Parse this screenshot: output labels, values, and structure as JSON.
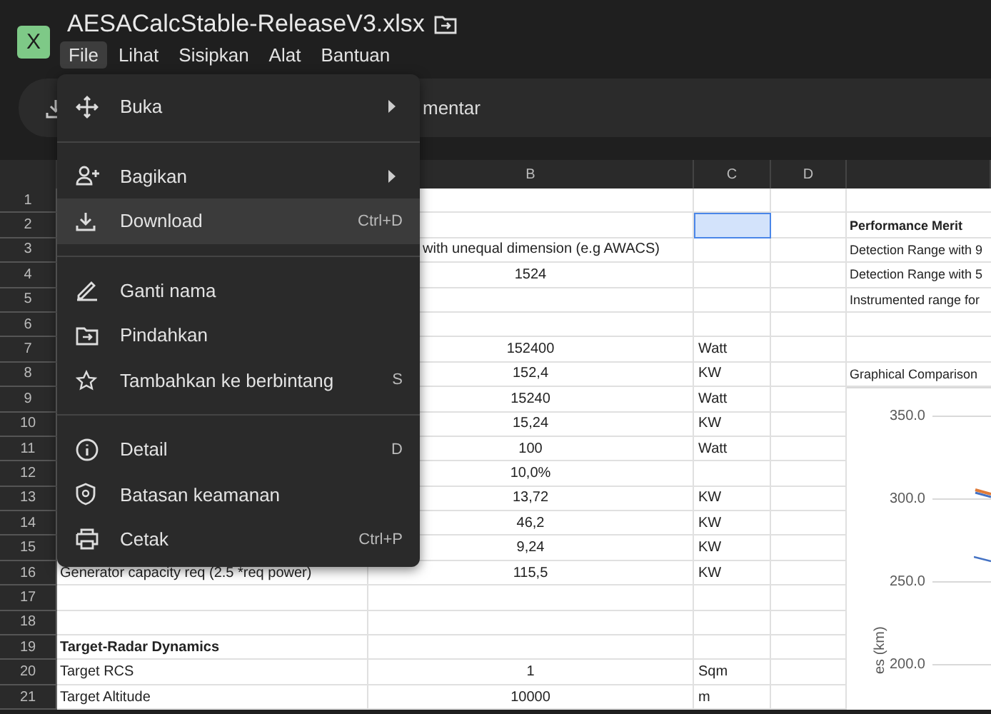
{
  "file": {
    "title": "AESACalcStable-ReleaseV3.xlsx",
    "app_icon_letter": "X"
  },
  "menubar": [
    {
      "label": "File",
      "selected": true
    },
    {
      "label": "Lihat",
      "selected": false
    },
    {
      "label": "Sisipkan",
      "selected": false
    },
    {
      "label": "Alat",
      "selected": false
    },
    {
      "label": "Bantuan",
      "selected": false
    }
  ],
  "toolbar": {
    "comment_text": "mentar"
  },
  "file_menu": {
    "sections": [
      [
        {
          "kind": "open",
          "label": "Buka",
          "submenu": true,
          "selected": false
        }
      ],
      [
        {
          "kind": "share",
          "label": "Bagikan",
          "submenu": true,
          "selected": false
        },
        {
          "kind": "download",
          "label": "Download",
          "shortcut": "Ctrl+D",
          "selected": true
        }
      ],
      [
        {
          "kind": "rename",
          "label": "Ganti nama",
          "selected": false
        },
        {
          "kind": "move",
          "label": "Pindahkan",
          "selected": false
        },
        {
          "kind": "star",
          "label": "Tambahkan ke berbintang",
          "shortcut": "S",
          "selected": false
        }
      ],
      [
        {
          "kind": "details",
          "label": "Detail",
          "shortcut": "D",
          "selected": false
        },
        {
          "kind": "security",
          "label": "Batasan keamanan",
          "selected": false
        },
        {
          "kind": "print",
          "label": "Cetak",
          "shortcut": "Ctrl+P",
          "selected": false
        }
      ]
    ]
  },
  "columns": [
    {
      "label": "B"
    },
    {
      "label": "C"
    },
    {
      "label": "D"
    }
  ],
  "rows": [
    {
      "number": "1",
      "c_selected": false
    },
    {
      "number": "2",
      "c_selected": true,
      "e": "Performance Merit",
      "e_bold": true
    },
    {
      "number": "3",
      "c_selected": false,
      "overflow_text": "with unequal dimension (e.g AWACS)",
      "e": "Detection Range with 9"
    },
    {
      "number": "4",
      "c_selected": false,
      "b": "1524",
      "e": "Detection Range with 5"
    },
    {
      "number": "5",
      "c_selected": false,
      "e": "Instrumented range for"
    },
    {
      "number": "6",
      "c_selected": false
    },
    {
      "number": "7",
      "c_selected": false,
      "b": "152400",
      "c": "Watt"
    },
    {
      "number": "8",
      "c_selected": false,
      "b": "152,4",
      "c": "KW",
      "e": "Graphical Comparison"
    },
    {
      "number": "9",
      "c_selected": false,
      "b": "15240",
      "c": "Watt"
    },
    {
      "number": "10",
      "c_selected": false,
      "b": "15,24",
      "c": "KW"
    },
    {
      "number": "11",
      "c_selected": false,
      "b": "100",
      "c": "Watt"
    },
    {
      "number": "12",
      "c_selected": false,
      "b": "10,0%"
    },
    {
      "number": "13",
      "c_selected": false,
      "b": "13,72",
      "c": "KW"
    },
    {
      "number": "14",
      "c_selected": false,
      "b": "46,2",
      "c": "KW"
    },
    {
      "number": "15",
      "c_selected": false,
      "b": "9,24",
      "c": "KW"
    },
    {
      "number": "16",
      "c_selected": false,
      "a": "Generator capacity req  (2.5 *req power)",
      "b": "115,5",
      "c": "KW"
    },
    {
      "number": "17",
      "c_selected": false
    },
    {
      "number": "18",
      "c_selected": false
    },
    {
      "number": "19",
      "c_selected": false,
      "a": "Target-Radar Dynamics",
      "a_bold": true
    },
    {
      "number": "20",
      "c_selected": false,
      "a": "Target RCS",
      "b": "1",
      "c": "Sqm"
    },
    {
      "number": "21",
      "c_selected": false,
      "a": "Target Altitude",
      "b": "10000",
      "c": "m"
    }
  ],
  "chart": {
    "y_ticks": [
      "350.0",
      "300.0",
      "250.0",
      "200.0"
    ],
    "y_axis_label": "es (km)"
  }
}
